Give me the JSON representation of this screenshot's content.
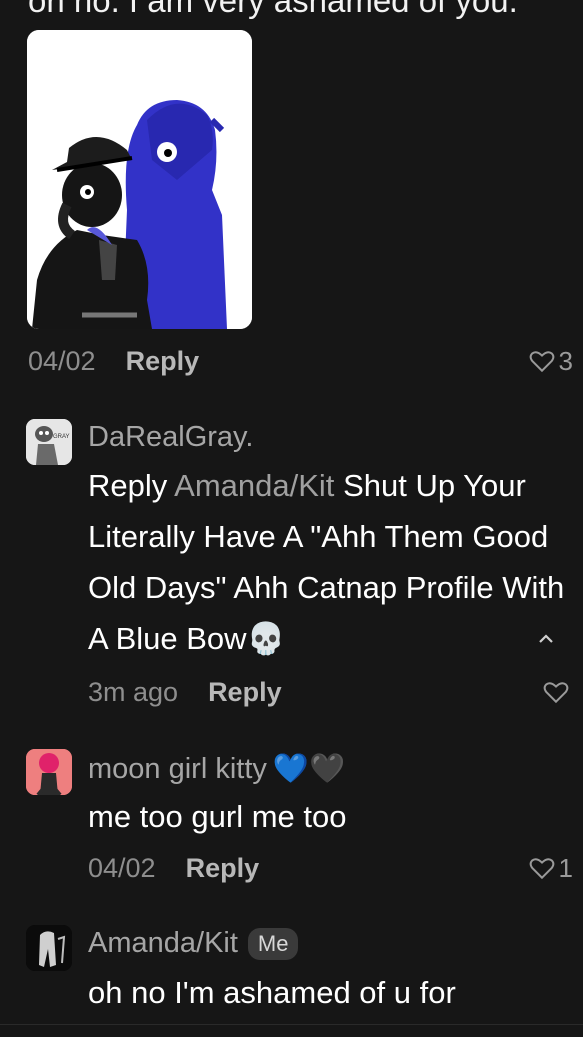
{
  "top_text": "oh no. I am very ashamed of you.",
  "comments": [
    {
      "time": "04/02",
      "reply_label": "Reply",
      "likes": "3",
      "image_icon": "drawing-image"
    },
    {
      "username": "DaRealGray.",
      "reply_prefix": "Reply",
      "mention": "Amanda/Kit",
      "text": "Shut Up Your Literally Have A \"Ahh Them Good Old Days\" Ahh Catnap Profile With A Blue Bow",
      "emoji": "💀",
      "time": "3m ago",
      "reply_label": "Reply"
    },
    {
      "username": "moon girl kitty",
      "emoji": "💙🖤",
      "text": "me too gurl me too",
      "time": "04/02",
      "reply_label": "Reply",
      "likes": "1"
    },
    {
      "username": "Amanda/Kit",
      "badge": "Me",
      "text": "oh no I'm ashamed of u for"
    }
  ],
  "colors": {
    "accent_heart": "#2b9cff",
    "background": "#161616"
  }
}
